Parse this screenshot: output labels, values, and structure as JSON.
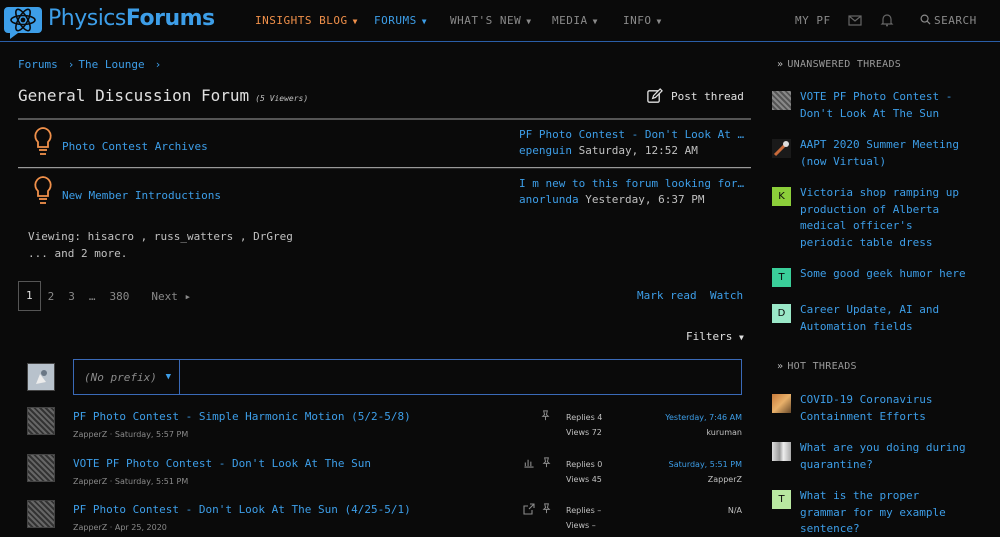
{
  "header": {
    "logo_text_a": "Physics",
    "logo_text_b": "Forums",
    "nav": {
      "insights": "INSIGHTS BLOG",
      "forums": "FORUMS",
      "whats_new": "WHAT'S NEW",
      "media": "MEDIA",
      "info": "INFO",
      "my_pf": "MY PF",
      "search": "SEARCH"
    }
  },
  "breadcrumb": {
    "forums": "Forums",
    "lounge": "The Lounge"
  },
  "page": {
    "title": "General Discussion Forum",
    "viewers": "(5 Viewers)",
    "post_thread": "Post thread"
  },
  "nodes": [
    {
      "title": "Photo Contest Archives",
      "latest_title": "PF Photo Contest - Don't Look At The Sun",
      "latest_user": "epenguin",
      "latest_time": "Saturday, 12:52 AM"
    },
    {
      "title": "New Member Introductions",
      "latest_title": "I m new to this forum looking for help",
      "latest_user": "anorlunda",
      "latest_time": "Yesterday, 6:37 PM"
    }
  ],
  "viewing": {
    "line1": "Viewing: hisacro , russ_watters , DrGreg",
    "line2": "... and 2 more."
  },
  "pager": {
    "p1": "1",
    "p2": "2",
    "p3": "3",
    "ellipsis": "…",
    "last": "380",
    "next": "Next ▸"
  },
  "actions": {
    "mark_read": "Mark read",
    "watch": "Watch",
    "filters": "Filters"
  },
  "prefix": {
    "label": "(No prefix)"
  },
  "threads": [
    {
      "title": "PF Photo Contest - Simple Harmonic Motion (5/2-5/8)",
      "author": "ZapperZ",
      "date": "Saturday, 5:57 PM",
      "replies": "Replies 4",
      "views": "Views 72",
      "last_date": "Yesterday, 7:46 AM",
      "last_user": "kuruman"
    },
    {
      "title": "VOTE PF Photo Contest - Don't Look At The Sun",
      "author": "ZapperZ",
      "date": "Saturday, 5:51 PM",
      "replies": "Replies 0",
      "views": "Views 45",
      "last_date": "Saturday, 5:51 PM",
      "last_user": "ZapperZ"
    },
    {
      "title": "PF Photo Contest - Don't Look At The Sun (4/25-5/1)",
      "author": "ZapperZ",
      "date": "Apr 25, 2020",
      "replies": "Replies –",
      "views": "Views –",
      "last_date": "N/A",
      "last_user": ""
    }
  ],
  "sidebar": {
    "unanswered_head": "UNANSWERED THREADS",
    "unanswered": [
      {
        "text": "VOTE PF Photo Contest - Don't Look At The Sun",
        "letter": ""
      },
      {
        "text": "AAPT 2020 Summer Meeting (now Virtual)",
        "letter": ""
      },
      {
        "text": "Victoria shop ramping up production of Alberta medical officer's periodic table dress",
        "letter": "K"
      },
      {
        "text": "Some good geek humor here",
        "letter": "T"
      },
      {
        "text": "Career Update, AI and Automation fields",
        "letter": "D"
      }
    ],
    "hot_head": "HOT THREADS",
    "hot": [
      {
        "text": "COVID-19 Coronavirus Containment Efforts",
        "letter": ""
      },
      {
        "text": "What are you doing during quarantine?",
        "letter": ""
      },
      {
        "text": "What is the proper grammar for my example sentence?",
        "letter": "T"
      }
    ]
  },
  "colors": {
    "accent": "#3d9ee8",
    "orange": "#f0904a",
    "bg": "#0a0a0a"
  }
}
